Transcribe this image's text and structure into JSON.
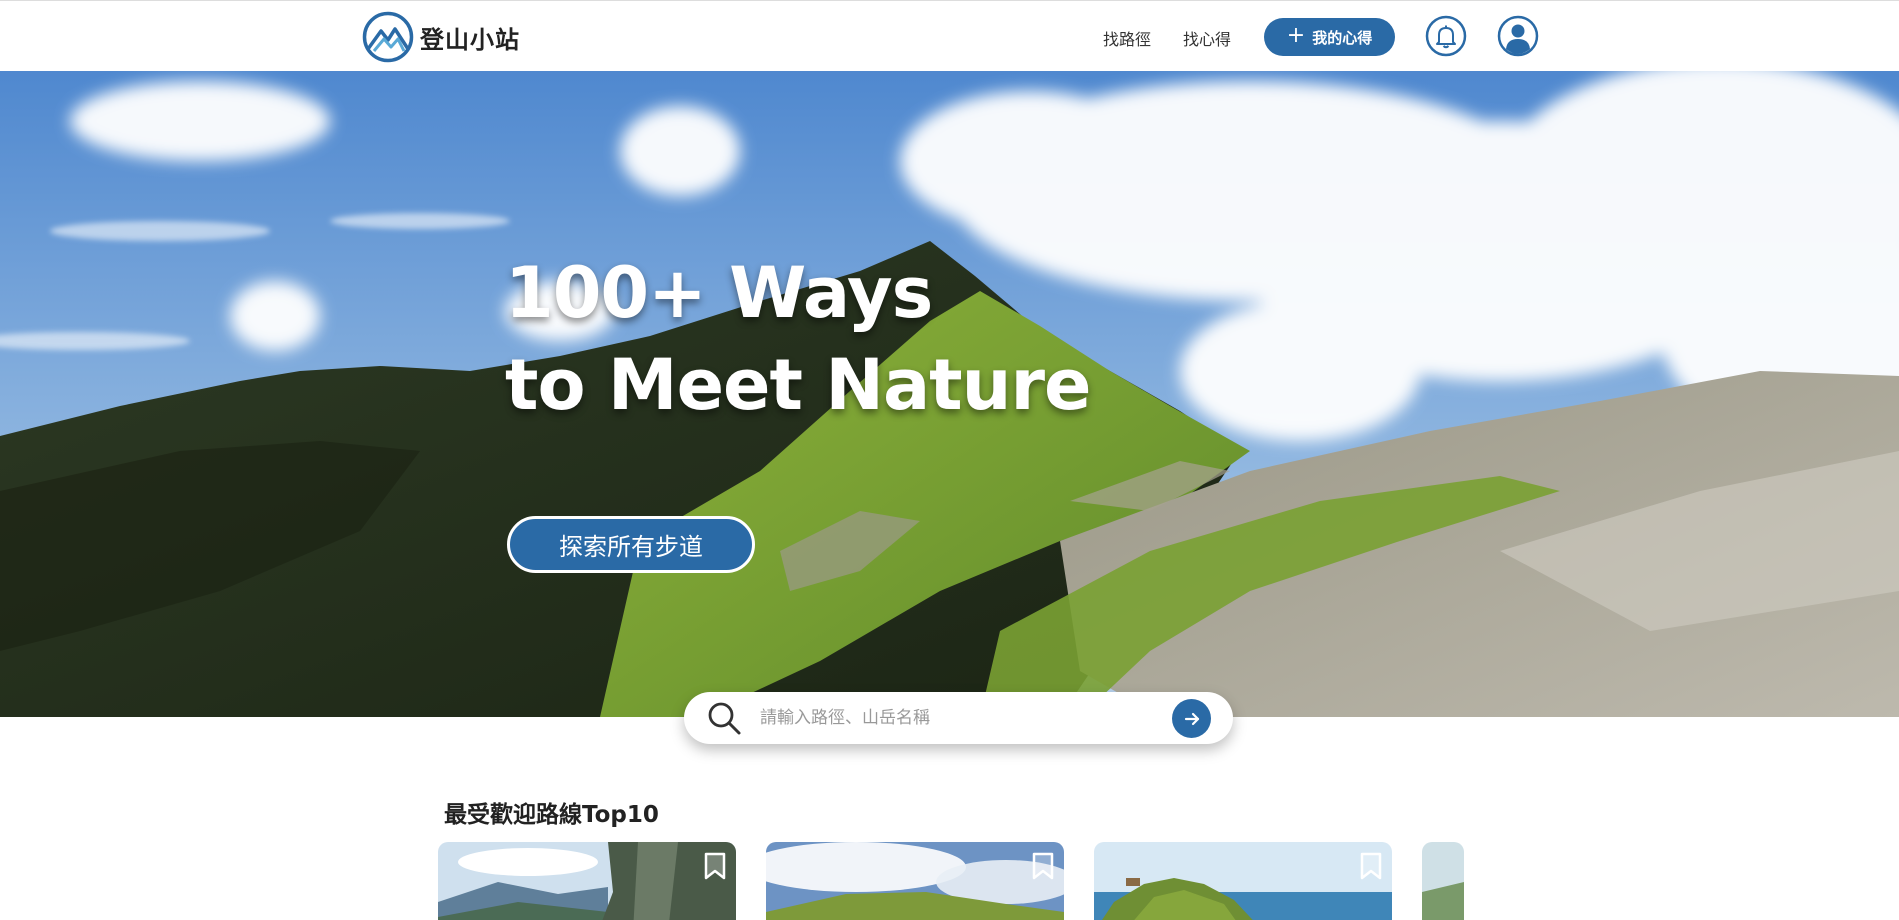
{
  "brand": {
    "name": "登山小站",
    "logo_icon": "mountain-logo-icon"
  },
  "nav": {
    "links": [
      "找路徑",
      "找心得"
    ],
    "cta_label": "我的心得",
    "cta_icon": "plus-icon",
    "notification_icon": "bell-icon",
    "profile_icon": "user-icon"
  },
  "hero": {
    "title_line1": "100+ Ways",
    "title_line2": "to Meet Nature",
    "button_label": "探索所有步道"
  },
  "search": {
    "placeholder": "請輸入路徑、山岳名稱",
    "value": "",
    "icon": "search-icon",
    "submit_icon": "arrow-right-icon"
  },
  "popular": {
    "title": "最受歡迎路線Top10",
    "bookmark_icon": "bookmark-icon"
  },
  "colors": {
    "primary": "#2a6aa6",
    "header_bg": "#ffffff",
    "text": "#222222"
  }
}
